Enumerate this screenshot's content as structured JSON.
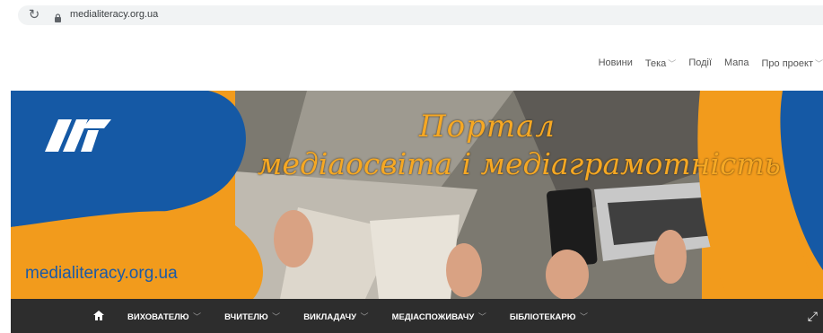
{
  "browser": {
    "url": "medialiteracy.org.ua"
  },
  "topnav": {
    "items": [
      {
        "label": "Новини",
        "has_dropdown": false
      },
      {
        "label": "Тека",
        "has_dropdown": true
      },
      {
        "label": "Події",
        "has_dropdown": false
      },
      {
        "label": "Мапа",
        "has_dropdown": false
      },
      {
        "label": "Про проект",
        "has_dropdown": true
      }
    ]
  },
  "banner": {
    "title_line1": "Портал",
    "title_line2": "медіаосвіта і медіаграмотність",
    "site_url": "medialiteracy.org.ua",
    "logo_text": "МП",
    "colors": {
      "orange": "#f29b1c",
      "blue": "#1559a5",
      "title": "#f6a823"
    }
  },
  "mainnav": {
    "items": [
      {
        "label": "ВИХОВАТЕЛЮ"
      },
      {
        "label": "ВЧИТЕЛЮ"
      },
      {
        "label": "ВИКЛАДАЧУ"
      },
      {
        "label": "МЕДІАСПОЖИВАЧУ"
      },
      {
        "label": "БІБЛІОТЕКАРЮ"
      }
    ],
    "colors": {
      "background": "#2d2d2d"
    }
  },
  "icons": [
    "reload-icon",
    "lock-icon",
    "chevron-down-icon",
    "home-icon",
    "expand-icon"
  ]
}
